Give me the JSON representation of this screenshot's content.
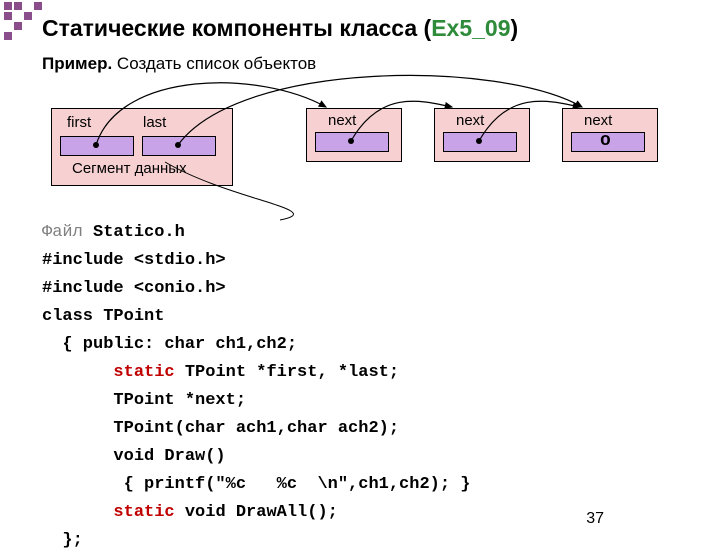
{
  "title": {
    "black": "Статические компоненты класса (",
    "green": "Ex5_09",
    "close": ")"
  },
  "subtitle": {
    "bold": "Пример.",
    "rest": " Создать список объектов"
  },
  "diagram": {
    "first": "first",
    "last": "last",
    "segment": "Сегмент данных",
    "next": "next",
    "null": "o"
  },
  "code": {
    "l1a": "Файл",
    "l1b": " Statico.h ",
    "l2": "#include <stdio.h>",
    "l3": "#include <conio.h>",
    "l4": "class TPoint",
    "l5": "  { public: char ch1,ch2;",
    "l6a": "       ",
    "l6s": "static",
    "l6b": " TPoint *first, *last;",
    "l7": "       TPoint *next;",
    "l8": "       TPoint(char ach1,char ach2);",
    "l9": "       void Draw()",
    "l10": "        { printf(\"%c   %c  \\n\",ch1,ch2); }",
    "l11a": "       ",
    "l11s": "static",
    "l11b": " void DrawAll();",
    "l12": "  };"
  },
  "page": "37"
}
